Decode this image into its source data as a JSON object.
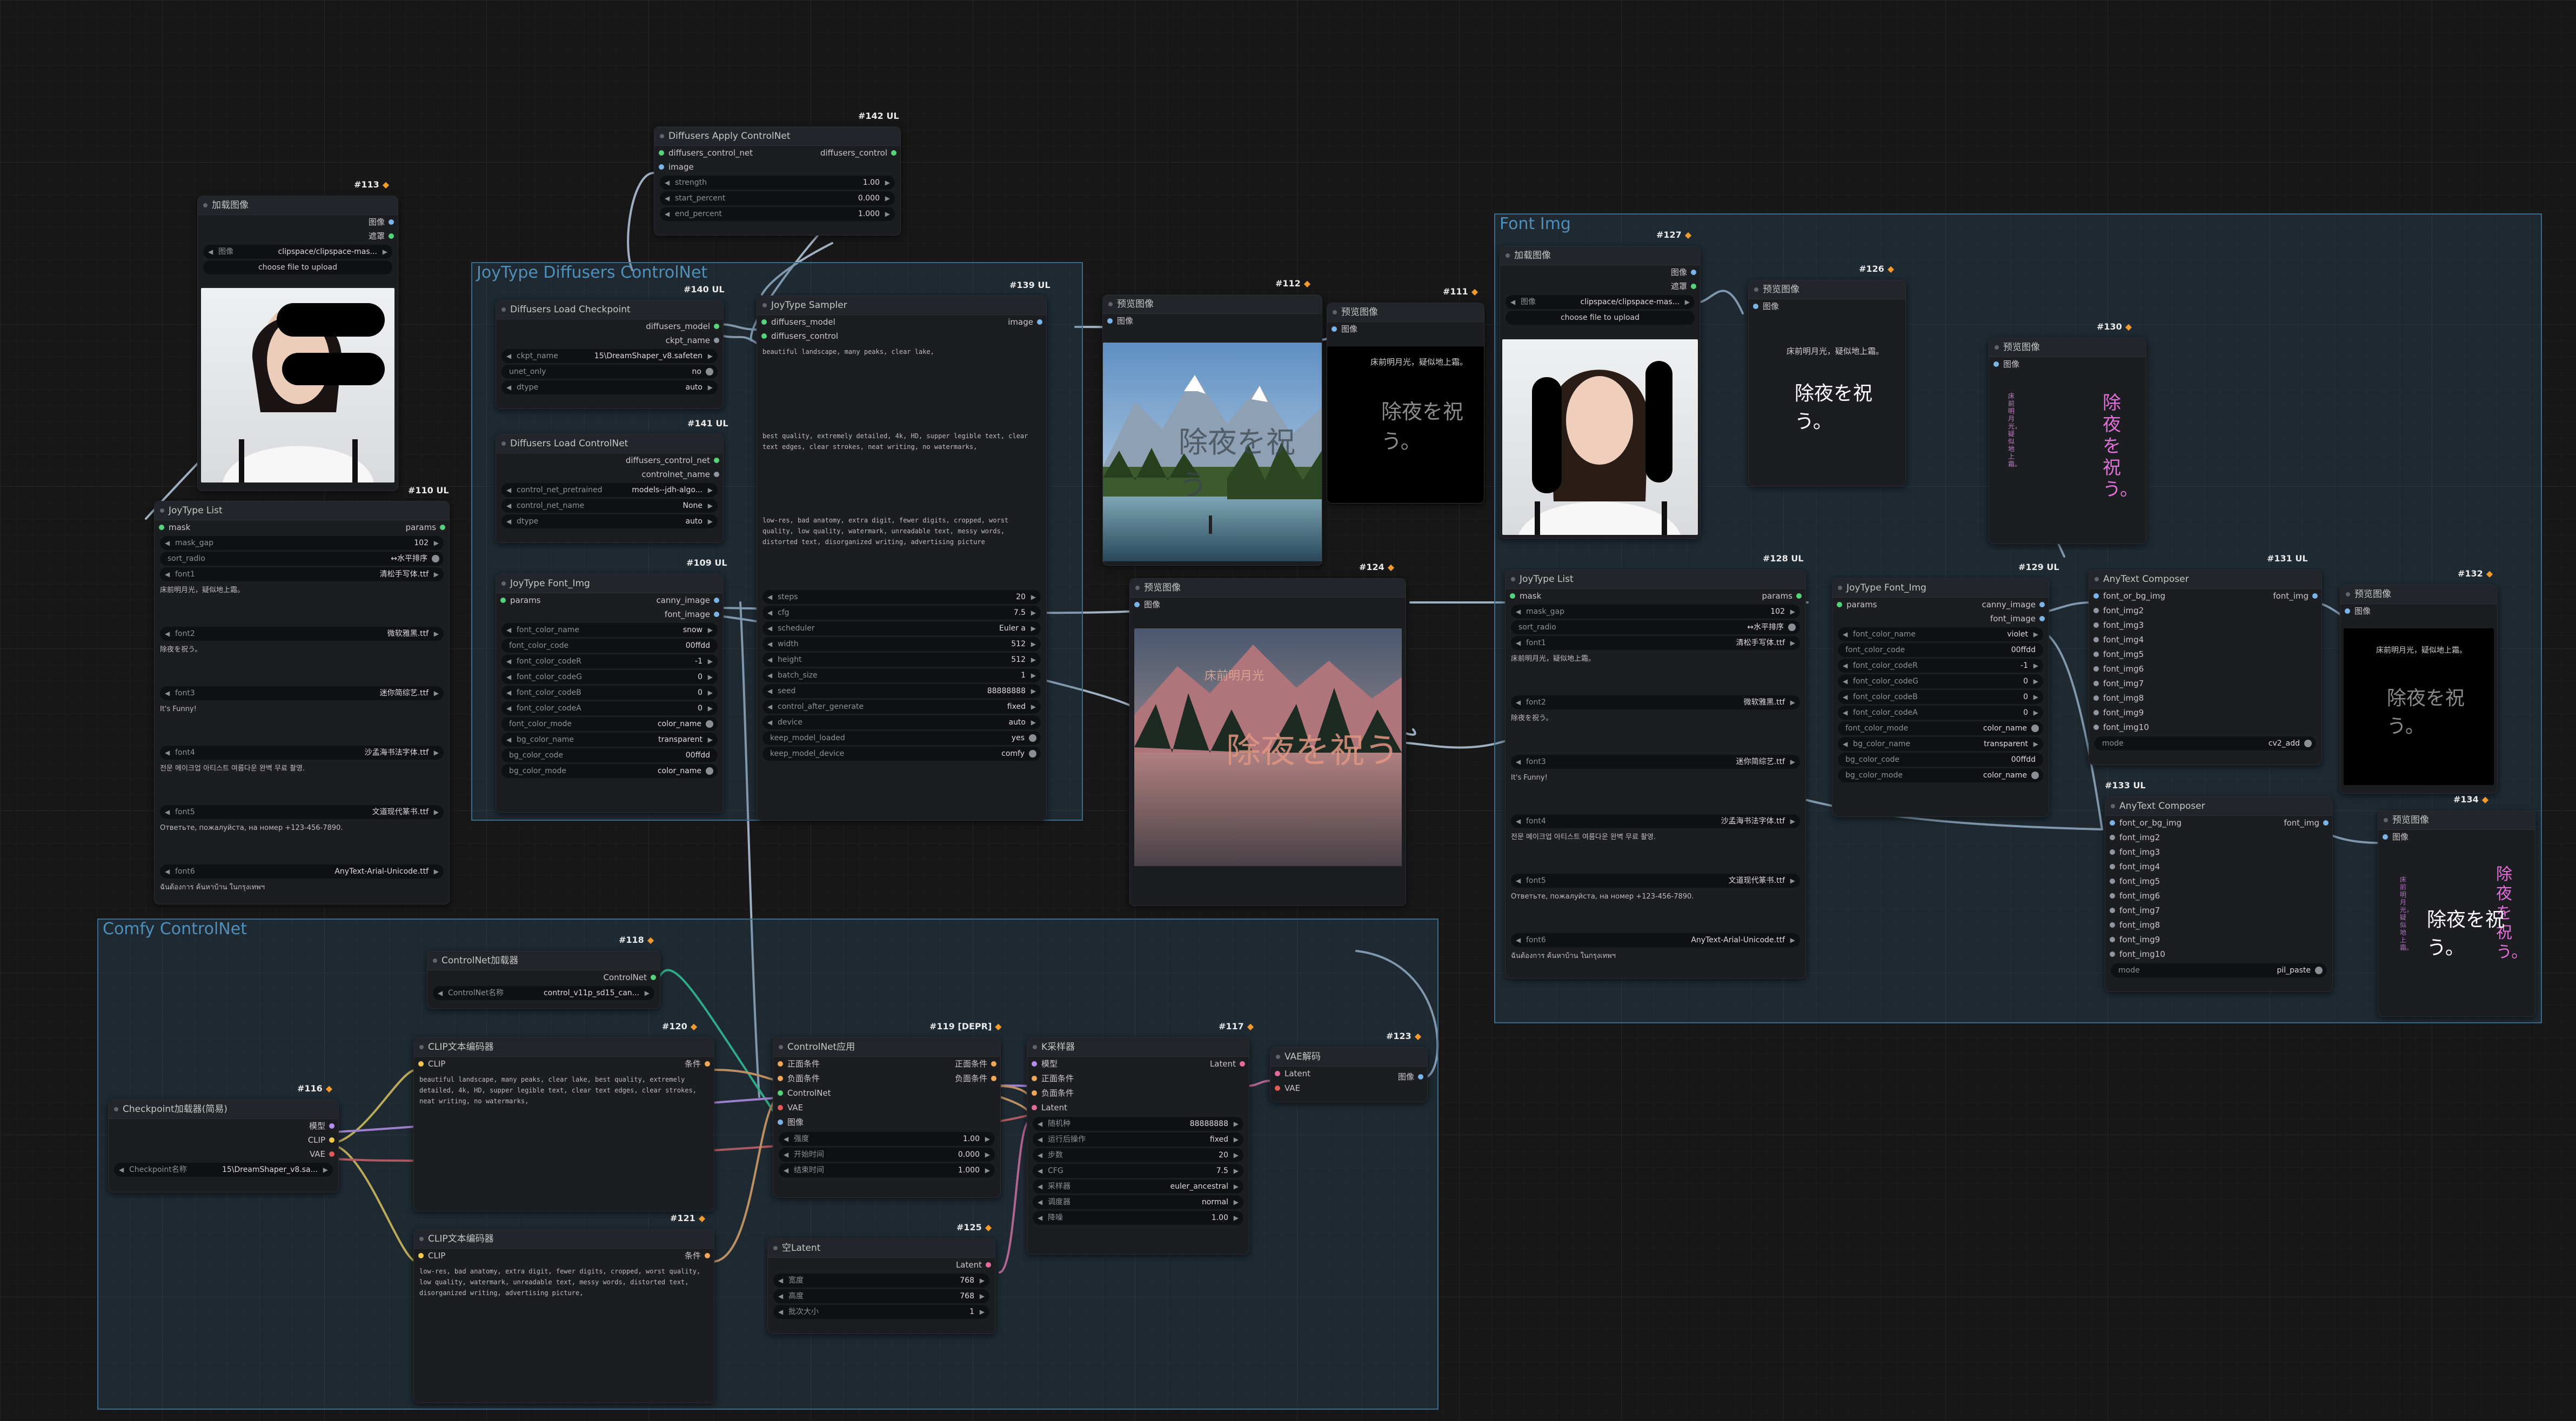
{
  "groups": {
    "joytype_controlnet": "JoyType Diffusers ControlNet",
    "comfy_controlnet": "Comfy ControlNet",
    "font_img": "Font Img"
  },
  "nodes": {
    "load_image_113": {
      "title": "加载图像",
      "badge": "#113",
      "outputs": [
        "图像",
        "遮罩"
      ],
      "image_label": "图像",
      "image_value": "clipspace/clipspace-mas...",
      "upload": "choose file to upload"
    },
    "apply_controlnet_142": {
      "title": "Diffusers Apply ControlNet",
      "badge": "#142 UL",
      "inputs": [
        "diffusers_control_net",
        "image"
      ],
      "output": "diffusers_control",
      "widgets": [
        [
          "strength",
          "1.00"
        ],
        [
          "start_percent",
          "0.000"
        ],
        [
          "end_percent",
          "1.000"
        ]
      ]
    },
    "load_checkpoint_140": {
      "title": "Diffusers Load Checkpoint",
      "badge": "#140 UL",
      "outputs": [
        "diffusers_model",
        "ckpt_name"
      ],
      "widgets": [
        [
          "ckpt_name",
          "15\\DreamShaper_v8.safeten"
        ],
        [
          "unet_only",
          "no"
        ],
        [
          "dtype",
          "auto"
        ]
      ]
    },
    "load_controlnet_141": {
      "title": "Diffusers Load ControlNet",
      "badge": "#141 UL",
      "outputs": [
        "diffusers_control_net",
        "controlnet_name"
      ],
      "widgets": [
        [
          "control_net_pretrained",
          "models--jdh-algo..."
        ],
        [
          "control_net_name",
          "None"
        ],
        [
          "dtype",
          "auto"
        ]
      ]
    },
    "font_img_109": {
      "title": "JoyType Font_Img",
      "badge": "#109 UL",
      "input": "params",
      "outputs": [
        "canny_image",
        "font_image"
      ],
      "widgets": [
        [
          "font_color_name",
          "snow"
        ],
        [
          "font_color_code",
          "00ffdd"
        ],
        [
          "font_color_codeR",
          "-1"
        ],
        [
          "font_color_codeG",
          "0"
        ],
        [
          "font_color_codeB",
          "0"
        ],
        [
          "font_color_codeA",
          "0"
        ],
        [
          "font_color_mode",
          "color_name"
        ],
        [
          "bg_color_name",
          "transparent"
        ],
        [
          "bg_color_code",
          "00ffdd"
        ],
        [
          "bg_color_mode",
          "color_name"
        ]
      ]
    },
    "sampler_139": {
      "title": "JoyType Sampler",
      "badge": "#139 UL",
      "inputs": [
        "diffusers_model",
        "diffusers_control"
      ],
      "output": "image",
      "prompt": "beautiful landscape, many peaks, clear lake,",
      "positive": "best quality, extremely detailed, 4k, HD, supper legible text, clear text edges, clear strokes, neat writing, no watermarks,",
      "negative": "low-res, bad anatomy, extra digit, fewer digits, cropped, worst quality, low quality, watermark, unreadable text, messy words, distorted text, disorganized writing, advertising picture",
      "widgets": [
        [
          "steps",
          "20"
        ],
        [
          "cfg",
          "7.5"
        ],
        [
          "scheduler",
          "Euler a"
        ],
        [
          "width",
          "512"
        ],
        [
          "height",
          "512"
        ],
        [
          "batch_size",
          "1"
        ],
        [
          "seed",
          "88888888"
        ],
        [
          "control_after_generate",
          "fixed"
        ],
        [
          "device",
          "auto"
        ],
        [
          "keep_model_loaded",
          "yes"
        ],
        [
          "keep_model_device",
          "comfy"
        ]
      ]
    },
    "joytype_list_110": {
      "title": "JoyType List",
      "badge": "#110 UL",
      "input": "mask",
      "output": "params",
      "mask_gap": "102",
      "sort_radio": "↔水平排序",
      "fonts": [
        [
          "font1",
          "清松手写体.ttf",
          "床前明月光，疑似地上霜。"
        ],
        [
          "font2",
          "微软雅黑.ttf",
          "除夜を祝う。"
        ],
        [
          "font3",
          "迷你简综艺.ttf",
          "It's Funny!"
        ],
        [
          "font4",
          "沙孟海书法字体.ttf",
          "전문 메이크업 아티스트 여름다운 완벽 무료 촬영."
        ],
        [
          "font5",
          "文道现代篆书.ttf",
          "Ответьте, пожалуйста, на номер +123-456-7890."
        ],
        [
          "font6",
          "AnyText-Arial-Unicode.ttf",
          "ฉันต้องการ ค้นหาบ้าน ในกรุงเทพฯ"
        ]
      ]
    },
    "preview_112": {
      "title": "预览图像",
      "badge": "#112",
      "input": "图像",
      "overlay": "除夜を祝う"
    },
    "preview_111": {
      "title": "预览图像",
      "badge": "#111",
      "input": "图像",
      "small": "床前明月光，疑似地上霜。",
      "big": "除夜を祝う。"
    },
    "preview_124": {
      "title": "预览图像",
      "badge": "#124",
      "input": "图像",
      "overlay": "除夜を祝う",
      "small": "床前明月光"
    },
    "load_image_127": {
      "title": "加载图像",
      "badge": "#127",
      "outputs": [
        "图像",
        "遮罩"
      ],
      "image_label": "图像",
      "image_value": "clipspace/clipspace-mas...",
      "upload": "choose file to upload"
    },
    "preview_126": {
      "title": "预览图像",
      "badge": "#126",
      "input": "图像",
      "small": "床前明月光，疑似地上霜。",
      "big": "除夜を祝う。"
    },
    "preview_130": {
      "title": "预览图像",
      "badge": "#130",
      "input": "图像",
      "vertical": "除夜を祝う。",
      "small": "床前明月光，疑似地上霜。"
    },
    "joytype_list_128": {
      "title": "JoyType List",
      "badge": "#128 UL",
      "input": "mask",
      "output": "params",
      "mask_gap": "102",
      "sort_radio": "↔水平排序",
      "fonts": [
        [
          "font1",
          "清松手写体.ttf",
          "床前明月光，疑似地上霜。"
        ],
        [
          "font2",
          "微软雅黑.ttf",
          "除夜を祝う。"
        ],
        [
          "font3",
          "迷你简综艺.ttf",
          "It's Funny!"
        ],
        [
          "font4",
          "沙孟海书法字体.ttf",
          "전문 메이크업 아티스트 여름다운 완벽 무료 촬영."
        ],
        [
          "font5",
          "文道现代篆书.ttf",
          "Ответьте, пожалуйста, на номер +123-456-7890."
        ],
        [
          "font6",
          "AnyText-Arial-Unicode.ttf",
          "ฉันต้องการ ค้นหาบ้าน ในกรุงเทพฯ"
        ]
      ]
    },
    "font_img_129": {
      "title": "JoyType Font_Img",
      "badge": "#129 UL",
      "input": "params",
      "outputs": [
        "canny_image",
        "font_image"
      ],
      "widgets": [
        [
          "font_color_name",
          "violet"
        ],
        [
          "font_color_code",
          "00ffdd"
        ],
        [
          "font_color_codeR",
          "-1"
        ],
        [
          "font_color_codeG",
          "0"
        ],
        [
          "font_color_codeB",
          "0"
        ],
        [
          "font_color_codeA",
          "0"
        ],
        [
          "font_color_mode",
          "color_name"
        ],
        [
          "bg_color_name",
          "transparent"
        ],
        [
          "bg_color_code",
          "00ffdd"
        ],
        [
          "bg_color_mode",
          "color_name"
        ]
      ]
    },
    "composer_131": {
      "title": "AnyText Composer",
      "badge": "#131 UL",
      "inputs": [
        "font_or_bg_img",
        "font_img2",
        "font_img3",
        "font_img4",
        "font_img5",
        "font_img6",
        "font_img7",
        "font_img8",
        "font_img9",
        "font_img10"
      ],
      "output": "font_img",
      "mode_label": "mode",
      "mode_value": "cv2_add"
    },
    "preview_132": {
      "title": "预览图像",
      "badge": "#132",
      "input": "图像",
      "big": "除夜を祝う。",
      "small": "床前明月光，疑似地上霜。"
    },
    "composer_133": {
      "title": "AnyText Composer",
      "badge": "#133 UL",
      "inputs": [
        "font_or_bg_img",
        "font_img2",
        "font_img3",
        "font_img4",
        "font_img5",
        "font_img6",
        "font_img7",
        "font_img8",
        "font_img9",
        "font_img10"
      ],
      "output": "font_img",
      "mode_label": "mode",
      "mode_value": "pil_paste"
    },
    "preview_134": {
      "title": "预览图像",
      "badge": "#134",
      "input": "图像",
      "big": "除夜を祝う。",
      "vertical": "除夜を祝う。",
      "small": "床前明月光，疑似地上霜。"
    },
    "controlnet_loader_118": {
      "title": "ControlNet加载器",
      "badge": "#118",
      "output": "ControlNet",
      "widget": [
        "ControlNet名称",
        "control_v11p_sd15_can..."
      ]
    },
    "clip_text_120": {
      "title": "CLIP文本编码器",
      "badge": "#120",
      "input": "CLIP",
      "output": "条件",
      "text": "beautiful landscape, many peaks, clear lake, best quality, extremely detailed, 4k, HD, supper legible text, clear text edges, clear strokes, neat writing, no watermarks,"
    },
    "clip_text_121": {
      "title": "CLIP文本编码器",
      "badge": "#121",
      "input": "CLIP",
      "output": "条件",
      "text": "low-res, bad anatomy, extra digit, fewer digits, cropped, worst quality, low quality, watermark, unreadable text, messy words, distorted text, disorganized writing, advertising picture,"
    },
    "checkpoint_116": {
      "title": "Checkpoint加载器(简易)",
      "badge": "#116",
      "outputs": [
        "模型",
        "CLIP",
        "VAE"
      ],
      "widget": [
        "Checkpoint名称",
        "15\\DreamShaper_v8.sa..."
      ]
    },
    "controlnet_apply_119": {
      "title": "ControlNet应用",
      "badge": "#119 [DEPR]",
      "inputs": [
        "正面条件",
        "负面条件",
        "ControlNet",
        "VAE",
        "图像"
      ],
      "outputs": [
        "正面条件",
        "负面条件"
      ],
      "widgets": [
        [
          "强度",
          "1.00"
        ],
        [
          "开始时间",
          "0.000"
        ],
        [
          "结束时间",
          "1.000"
        ]
      ]
    },
    "ksampler_117": {
      "title": "K采样器",
      "badge": "#117",
      "inputs": [
        "模型",
        "正面条件",
        "负面条件",
        "Latent"
      ],
      "output": "Latent",
      "widgets": [
        [
          "随机种",
          "88888888"
        ],
        [
          "运行后操作",
          "fixed"
        ],
        [
          "步数",
          "20"
        ],
        [
          "CFG",
          "7.5"
        ],
        [
          "采样器",
          "euler_ancestral"
        ],
        [
          "调度器",
          "normal"
        ],
        [
          "降噪",
          "1.00"
        ]
      ]
    },
    "vae_decode_123": {
      "title": "VAE解码",
      "badge": "#123",
      "inputs": [
        "Latent",
        "VAE"
      ],
      "output": "图像"
    },
    "empty_latent_125": {
      "title": "空Latent",
      "badge": "#125",
      "output": "Latent",
      "widgets": [
        [
          "宽度",
          "768"
        ],
        [
          "高度",
          "768"
        ],
        [
          "批次大小",
          "1"
        ]
      ]
    }
  },
  "colors": {
    "accent_group": "#3a6a8c",
    "background": "#171717",
    "node": "#1b1d21"
  }
}
